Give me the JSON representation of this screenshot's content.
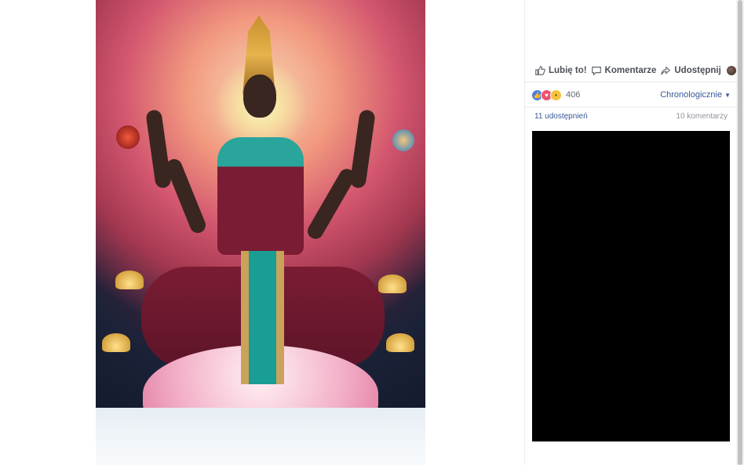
{
  "actions": {
    "like_label": "Lubię to!",
    "comment_label": "Komentarze",
    "share_label": "Udostępnij"
  },
  "reactions": {
    "count": "406",
    "sort_label": "Chronologicznie",
    "types": [
      "like-icon",
      "love-icon",
      "wow-icon"
    ]
  },
  "stats": {
    "shares": "11 udostępnień",
    "comments": "10 komentarzy"
  },
  "colors": {
    "link": "#385898",
    "action_text": "#4b4f56",
    "muted": "#90949c",
    "panel": "#000000"
  }
}
